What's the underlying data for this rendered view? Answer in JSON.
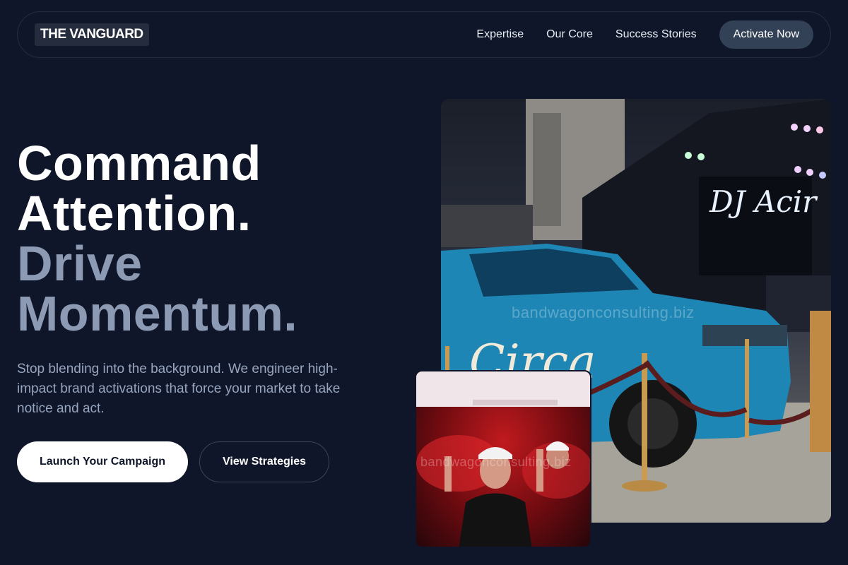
{
  "nav": {
    "logo": "THE VANGUARD",
    "links": [
      "Expertise",
      "Our Core",
      "Success Stories"
    ],
    "cta": "Activate Now"
  },
  "hero": {
    "headline_line1": "Command",
    "headline_line2": "Attention.",
    "headline_line3": "Drive",
    "headline_line4": "Momentum.",
    "subtext": "Stop blending into the background. We engineer high-impact brand activations that force your market to take notice and act.",
    "primary_cta": "Launch Your Campaign",
    "secondary_cta": "View Strategies"
  },
  "images": {
    "watermark": "bandwagonconsulting.biz",
    "main_truck_lettering": "Circa",
    "main_sign_text": "DJ Acir"
  },
  "colors": {
    "background": "#0f1629",
    "headline_muted": "#8d9ab4",
    "nav_cta_bg": "#334157",
    "truck_blue": "#1e86b5"
  }
}
